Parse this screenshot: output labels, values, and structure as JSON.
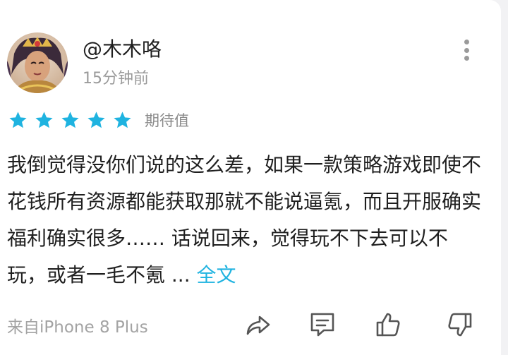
{
  "post": {
    "username": "@木木咯",
    "time": "15分钟前",
    "rating": {
      "stars": 5,
      "label": "期待值"
    },
    "body": "我倒觉得没你们说的这么差，如果一款策略游戏即使不花钱所有资源都能获取那就不能说逼氪，而且开服确实福利确实很多…… 话说回来，觉得玩不下去可以不玩，或者一毛不氪 ... ",
    "expand_label": "全文",
    "device": "来自iPhone 8 Plus"
  },
  "icons": {
    "more": "more-vertical-icon",
    "share": "share-icon",
    "comment": "comment-icon",
    "like": "thumbs-up-icon",
    "dislike": "thumbs-down-icon",
    "star": "star-icon"
  },
  "colors": {
    "star": "#1fb3e0",
    "link": "#1fb3e0",
    "icon": "#555555"
  }
}
